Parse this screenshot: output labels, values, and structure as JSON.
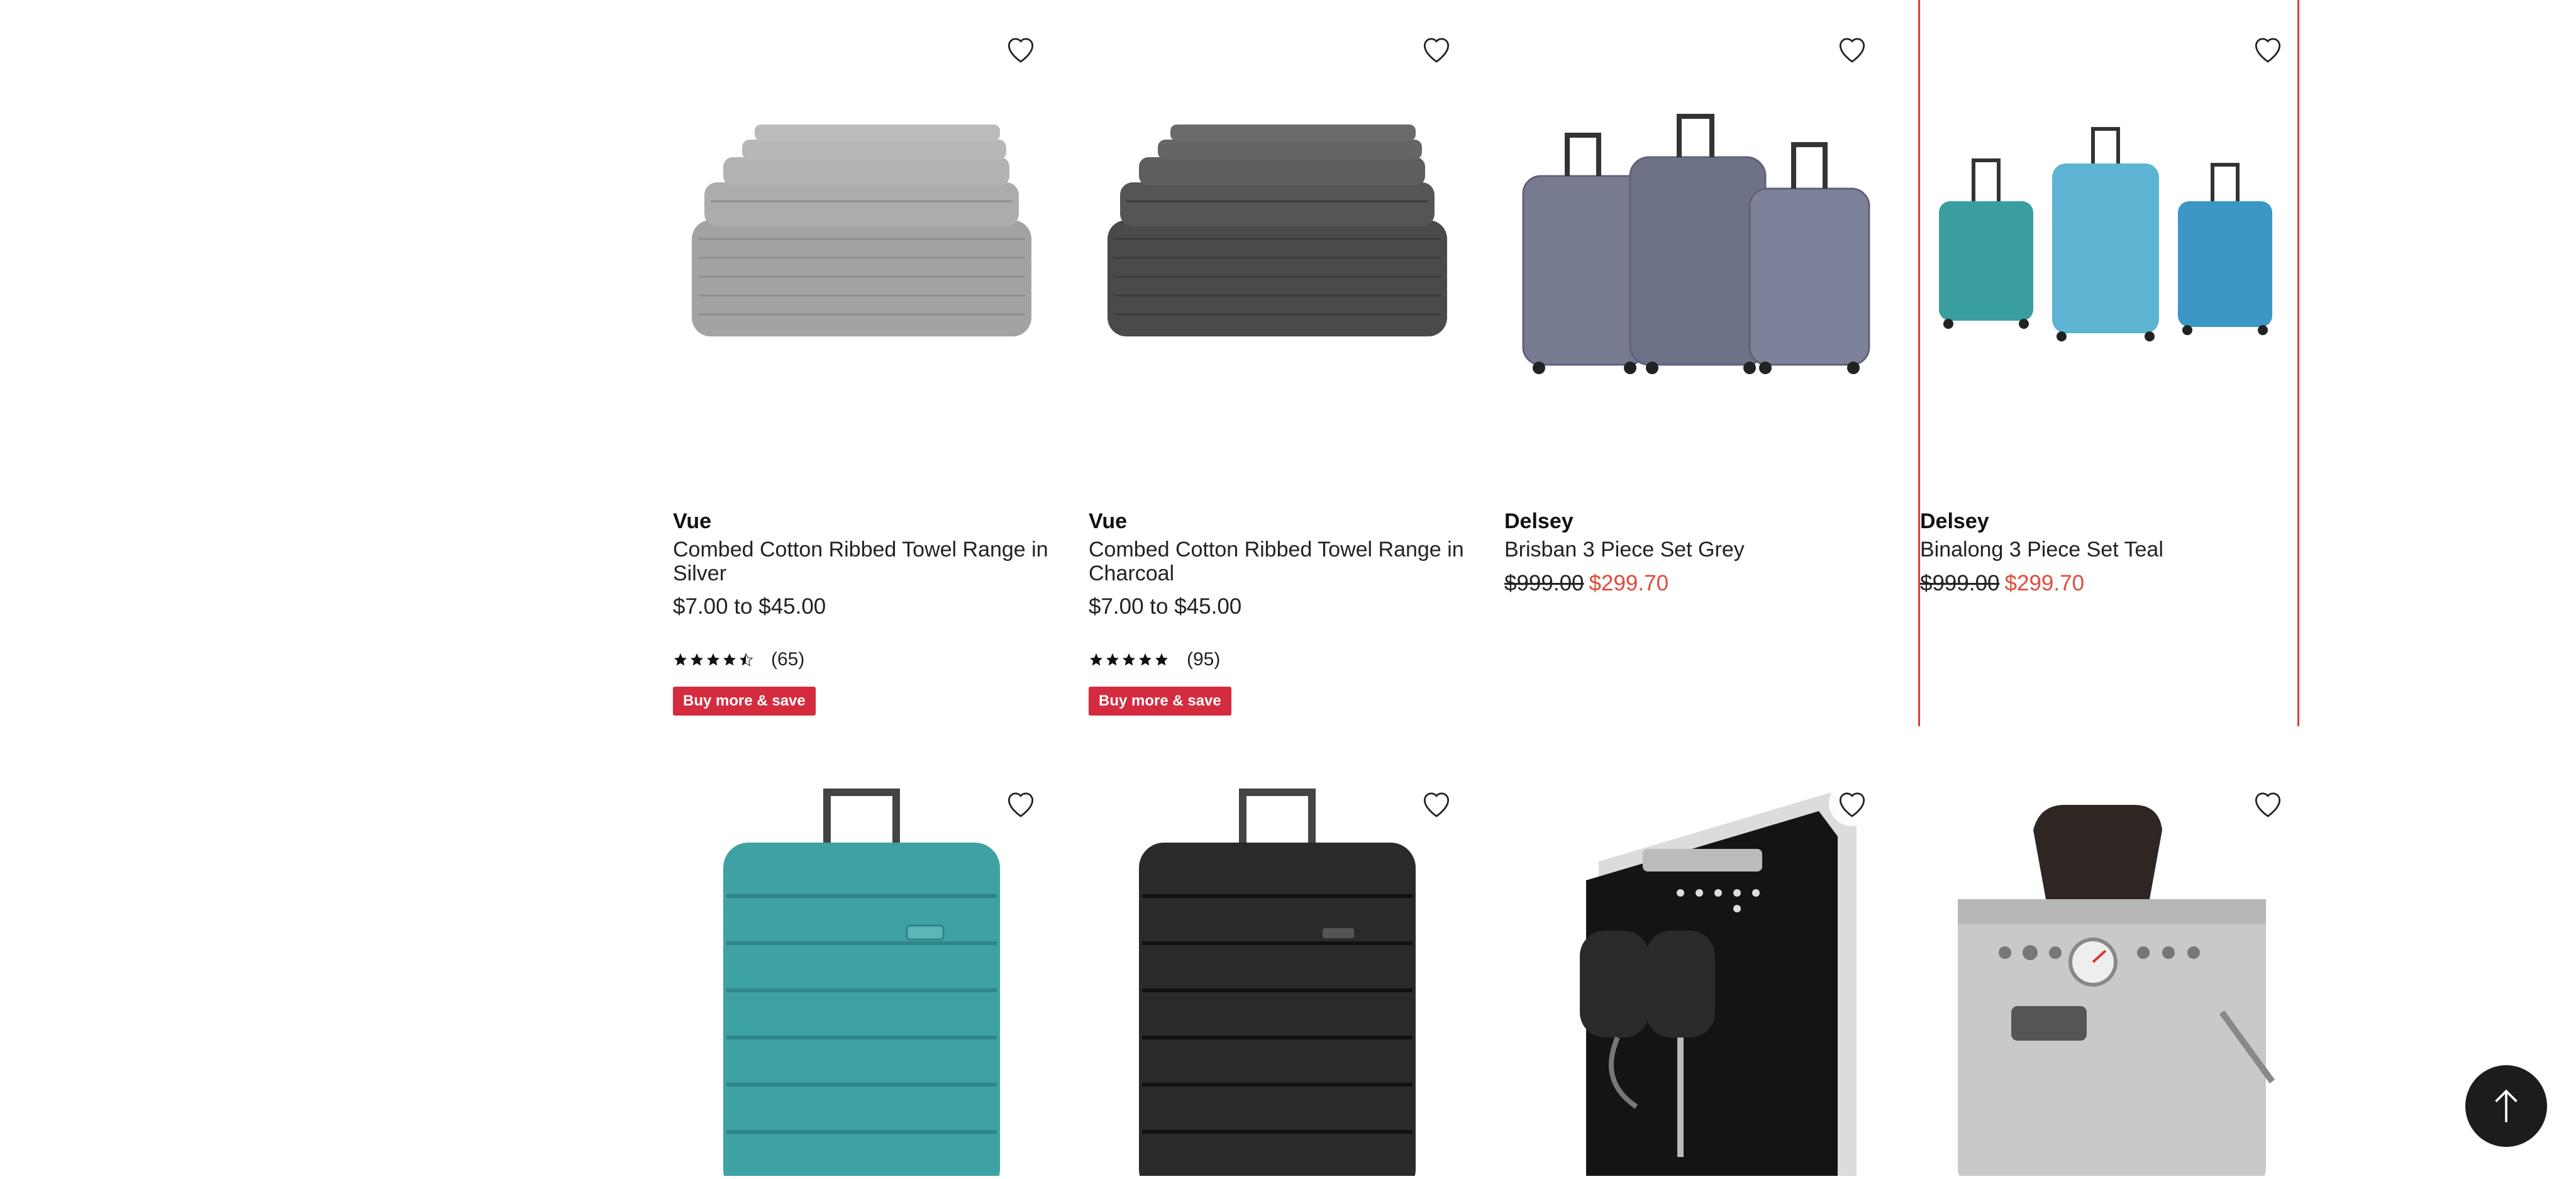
{
  "products_row1": [
    {
      "brand": "Vue",
      "name": "Combed Cotton Ribbed Towel Range in Silver",
      "price": "$7.00 to $45.00",
      "rating_count": "(65)",
      "rating": 4.5,
      "badge": "Buy more & save",
      "image": "silver-towels"
    },
    {
      "brand": "Vue",
      "name": "Combed Cotton Ribbed Towel Range in Charcoal",
      "price": "$7.00 to $45.00",
      "rating_count": "(95)",
      "rating": 5,
      "badge": "Buy more & save",
      "image": "charcoal-towels"
    },
    {
      "brand": "Delsey",
      "name": "Brisban 3 Piece Set Grey",
      "old_price": "$999.00",
      "sale_price": "$299.70",
      "image": "grey-luggage-set"
    },
    {
      "brand": "Delsey",
      "name": "Binalong 3 Piece Set Teal",
      "old_price": "$999.00",
      "sale_price": "$299.70",
      "image": "teal-luggage-set"
    }
  ],
  "products_row2": [
    {
      "image": "teal-suitcase"
    },
    {
      "image": "black-suitcase"
    },
    {
      "image": "black-coffee-machine"
    },
    {
      "image": "stainless-espresso-machine"
    }
  ],
  "colors": {
    "sale": "#e04b3b",
    "badge": "#d52b3e",
    "selected_outline": "#e0393e"
  },
  "icons": {
    "wishlist": "heart-icon",
    "back_to_top": "arrow-up-icon",
    "rating": "star-icon"
  }
}
